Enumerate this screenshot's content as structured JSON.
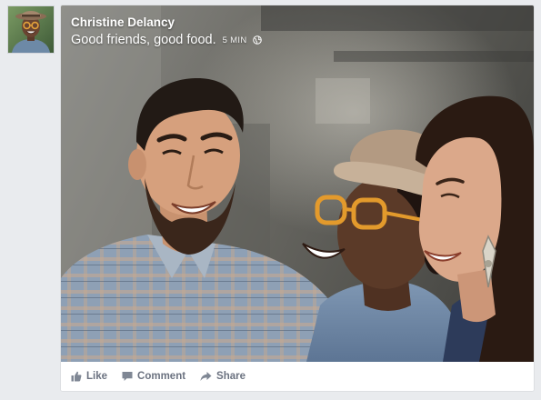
{
  "post": {
    "author": "Christine Delancy",
    "text": "Good friends, good food.",
    "timestamp": "5 MIN"
  },
  "actions": {
    "like_label": "Like",
    "comment_label": "Comment",
    "share_label": "Share"
  },
  "colors": {
    "page_background": "#e9ebee",
    "action_text": "#6b7280",
    "header_text": "#ffffff"
  },
  "icons": {
    "avatar": "profile-photo",
    "privacy": "globe-icon",
    "like": "thumbs-up-icon",
    "comment": "speech-bubble-icon",
    "share": "share-arrow-icon"
  }
}
